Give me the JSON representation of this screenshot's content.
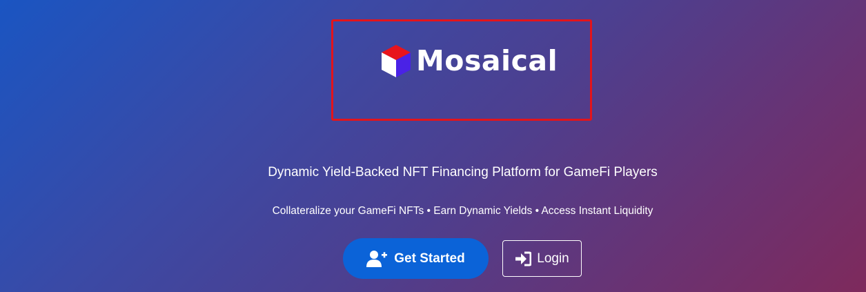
{
  "brand": {
    "name": "Mosaical",
    "logo_icon": "cube-logo-icon",
    "frame_color": "#e3141b"
  },
  "hero": {
    "tagline": "Dynamic Yield-Backed NFT Financing Platform for GameFi Players",
    "features": "Collateralize your GameFi NFTs • Earn Dynamic Yields • Access Instant Liquidity"
  },
  "actions": {
    "get_started": {
      "label": "Get Started",
      "icon": "user-plus-icon",
      "color": "#0b63d8"
    },
    "login": {
      "label": "Login",
      "icon": "sign-in-icon"
    }
  }
}
